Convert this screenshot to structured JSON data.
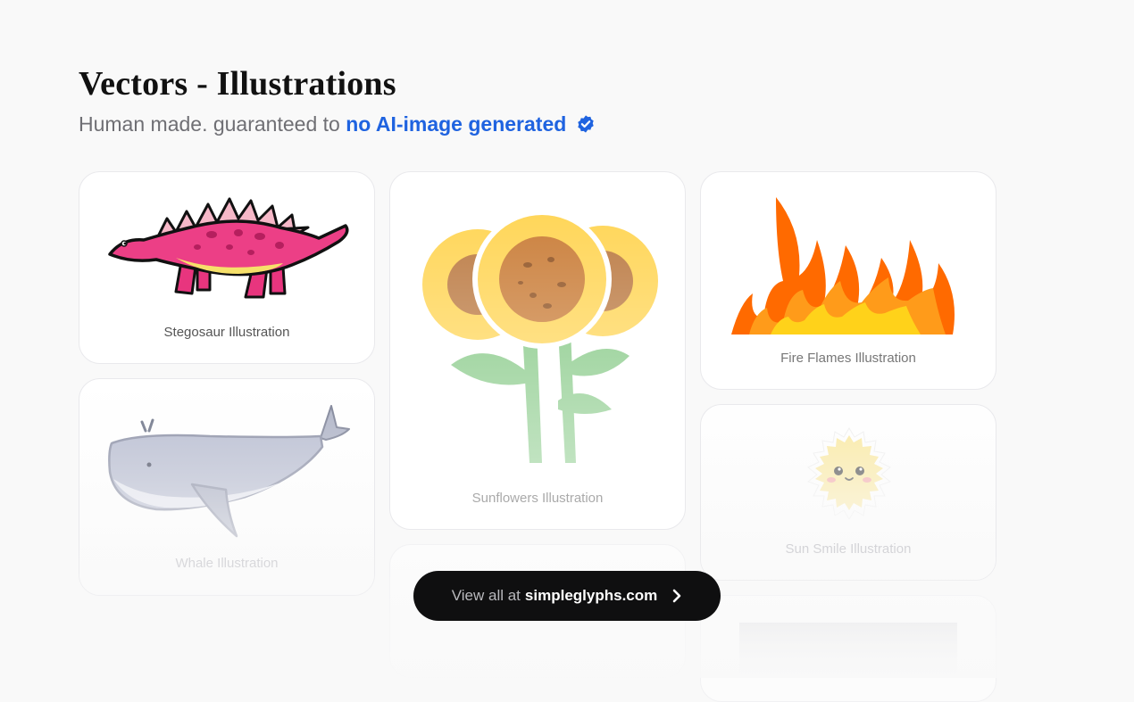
{
  "header": {
    "title": "Vectors - Illustrations",
    "subtitle_prefix": "Human made. guaranteed to",
    "subtitle_highlight": "no AI-image generated",
    "verified_icon": "verified-badge-icon"
  },
  "cards": [
    {
      "label": "Stegosaur Illustration",
      "icon": "stegosaur-illustration"
    },
    {
      "label": "Whale Illustration",
      "icon": "whale-illustration"
    },
    {
      "label": "Sunflowers Illustration",
      "icon": "sunflowers-illustration"
    },
    {
      "label": "Fire Flames Illustration",
      "icon": "fire-flames-illustration"
    },
    {
      "label": "Sun Smile Illustration",
      "icon": "sun-smile-illustration"
    }
  ],
  "cta": {
    "prefix": "View all at",
    "site": "simpleglyphs.com",
    "icon": "chevron-right-icon"
  },
  "colors": {
    "accent": "#1f63e0",
    "background": "#f9f9f9",
    "cta_background": "#0f0f10"
  }
}
